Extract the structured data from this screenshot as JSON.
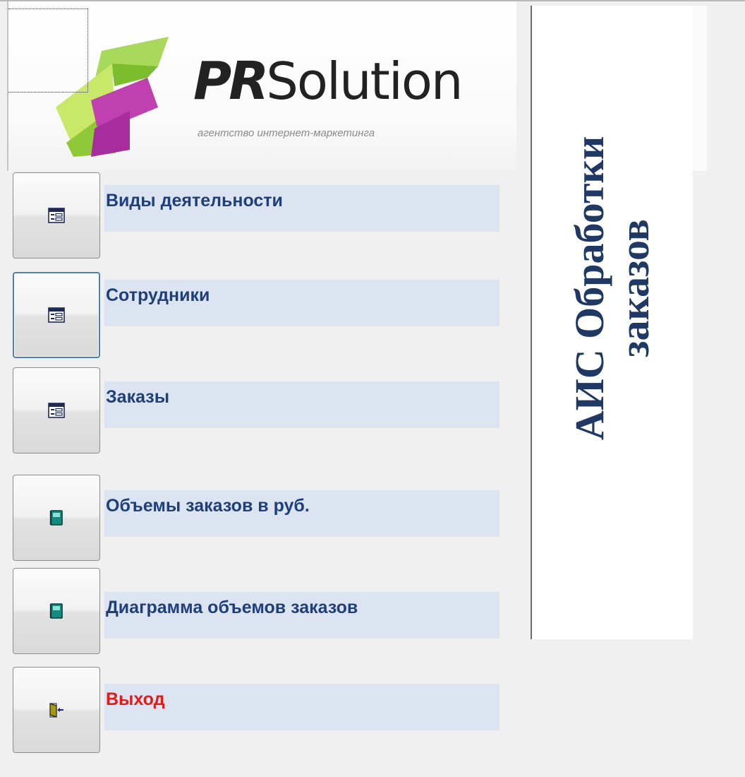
{
  "logo": {
    "brand_bold": "PR",
    "brand_rest": "Solution",
    "tagline": "агентство интернет-маркетинга"
  },
  "title": {
    "line1": "АИС Обработки",
    "line2": "заказов",
    "color": "#1f3864"
  },
  "menu": {
    "items": [
      {
        "label": "Виды деятельности",
        "icon": "form-icon"
      },
      {
        "label": "Сотрудники",
        "icon": "form-icon"
      },
      {
        "label": "Заказы",
        "icon": "form-icon"
      },
      {
        "label": "Объемы заказов в руб.",
        "icon": "report-icon"
      },
      {
        "label": "Диаграмма объемов заказов",
        "icon": "report-icon"
      },
      {
        "label": "Выход",
        "icon": "exit-door-icon"
      }
    ],
    "label_color": "#1f3f78",
    "exit_color": "#e11a1a"
  }
}
